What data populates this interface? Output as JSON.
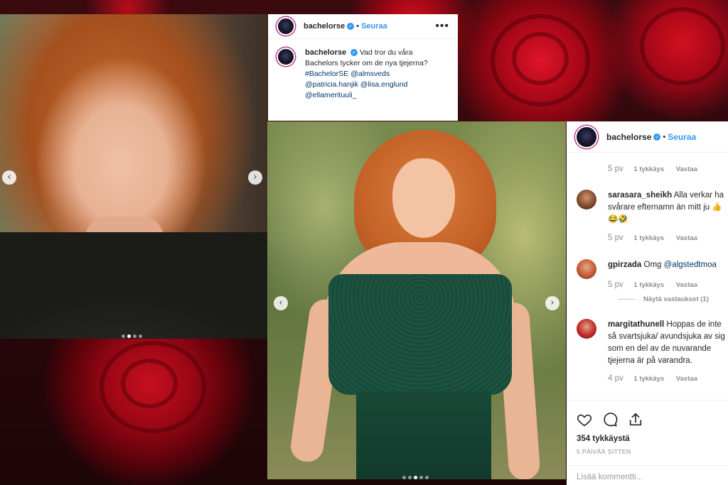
{
  "left_card": {
    "dots_total": 4,
    "dots_active_index": 1
  },
  "post_header": {
    "username": "bachelorse",
    "separator": "•",
    "follow_label": "Seuraa",
    "more_label": "•••"
  },
  "caption": {
    "username": "bachelorse",
    "text_line1": "Vad tror du våra",
    "text_line2": "Bachelors tycker om de nya tjejerna?",
    "hashtag": "#BachelorSE",
    "mention1": "@almsveds",
    "mention2": "@patricia.hanjik",
    "mention3": "@lisa.englund",
    "mention4": "@ellamerituuli_"
  },
  "center_photo": {
    "dots_total": 5,
    "dots_active_index": 2
  },
  "comments_panel": {
    "username": "bachelorse",
    "separator": "•",
    "follow_label": "Seuraa",
    "comments": [
      {
        "username": "",
        "text": "",
        "age": "5 pv",
        "likes": "1 tykkäys",
        "reply": "Vastaa"
      },
      {
        "username": "sarasara_sheikh",
        "text": "Alla verkar ha",
        "text2": "svårare efternamn än mitt ju 👍",
        "text3": "😂🤣",
        "age": "5 pv",
        "likes": "1 tykkäys",
        "reply": "Vastaa"
      },
      {
        "username": "gpirzada",
        "text": "Omg",
        "mention": "@algstedtmoa",
        "age": "5 pv",
        "likes": "1 tykkäys",
        "reply": "Vastaa",
        "view_replies": "Näytä vastaukset (1)"
      },
      {
        "username": "margitathunell",
        "text": "Hoppas de inte",
        "text2": "så svartsjuka/ avundsjuka av sig",
        "text3": "som en del av de nuvarande",
        "text4": "tjejerna är på varandra.",
        "age": "4 pv",
        "likes": "1 tykkäys",
        "reply": "Vastaa"
      }
    ],
    "likes_count": "354 tykkäystä",
    "timestamp": "5 PÄIVÄÄ SITTEN",
    "add_comment_placeholder": "Lisää kommentti..."
  },
  "colors": {
    "accent_blue": "#3897f0",
    "link_navy": "#003569",
    "text": "#262626",
    "muted": "#8e8e8e",
    "rose_red": "#c8101f"
  }
}
